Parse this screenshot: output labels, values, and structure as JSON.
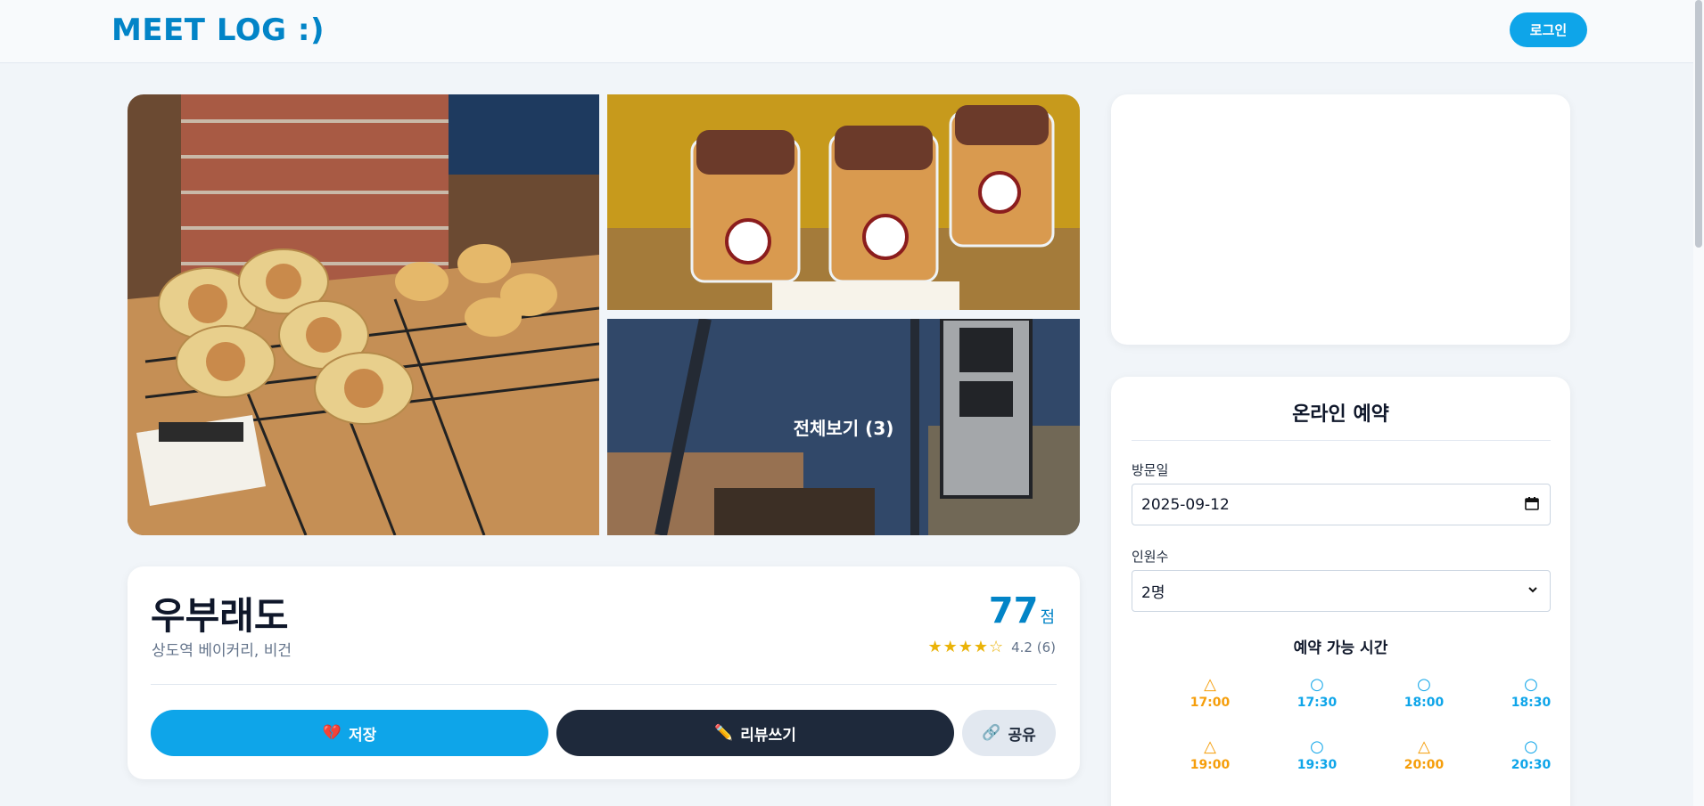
{
  "header": {
    "logo": "MEET LOG :)",
    "login_label": "로그인"
  },
  "gallery": {
    "view_all_label": "전체보기 (3)"
  },
  "restaurant": {
    "name": "우부래도",
    "subtitle": "상도역 베이커리, 비건",
    "score": "77",
    "score_unit": "점",
    "stars": "★★★★☆",
    "rating": "4.2 (6)",
    "rating_value": 4.2,
    "review_count": 6
  },
  "actions": {
    "save_icon": "💔",
    "save_label": "저장",
    "review_icon": "✏️",
    "review_label": "리뷰쓰기",
    "share_icon": "🔗",
    "share_label": "공유"
  },
  "reservation": {
    "title": "온라인 예약",
    "date_label": "방문일",
    "date_value": "2025-09-12",
    "people_label": "인원수",
    "people_value": "2명",
    "times_title": "예약 가능 시간",
    "slots": [
      {
        "symbol": "△",
        "time": "17:00",
        "status": "limited"
      },
      {
        "symbol": "○",
        "time": "17:30",
        "status": "open"
      },
      {
        "symbol": "○",
        "time": "18:00",
        "status": "open"
      },
      {
        "symbol": "○",
        "time": "18:30",
        "status": "open"
      },
      {
        "symbol": "△",
        "time": "19:00",
        "status": "limited"
      },
      {
        "symbol": "○",
        "time": "19:30",
        "status": "open"
      },
      {
        "symbol": "△",
        "time": "20:00",
        "status": "limited"
      },
      {
        "symbol": "○",
        "time": "20:30",
        "status": "open"
      }
    ]
  },
  "colors": {
    "primary": "#0ea5e9",
    "brand": "#0284c7",
    "dark": "#1e293b",
    "limited": "#f59e0b"
  },
  "icons": {
    "save": "broken-heart-icon",
    "review": "pencil-icon",
    "share": "link-icon",
    "calendar": "calendar-icon",
    "dropdown": "chevron-down-icon"
  }
}
